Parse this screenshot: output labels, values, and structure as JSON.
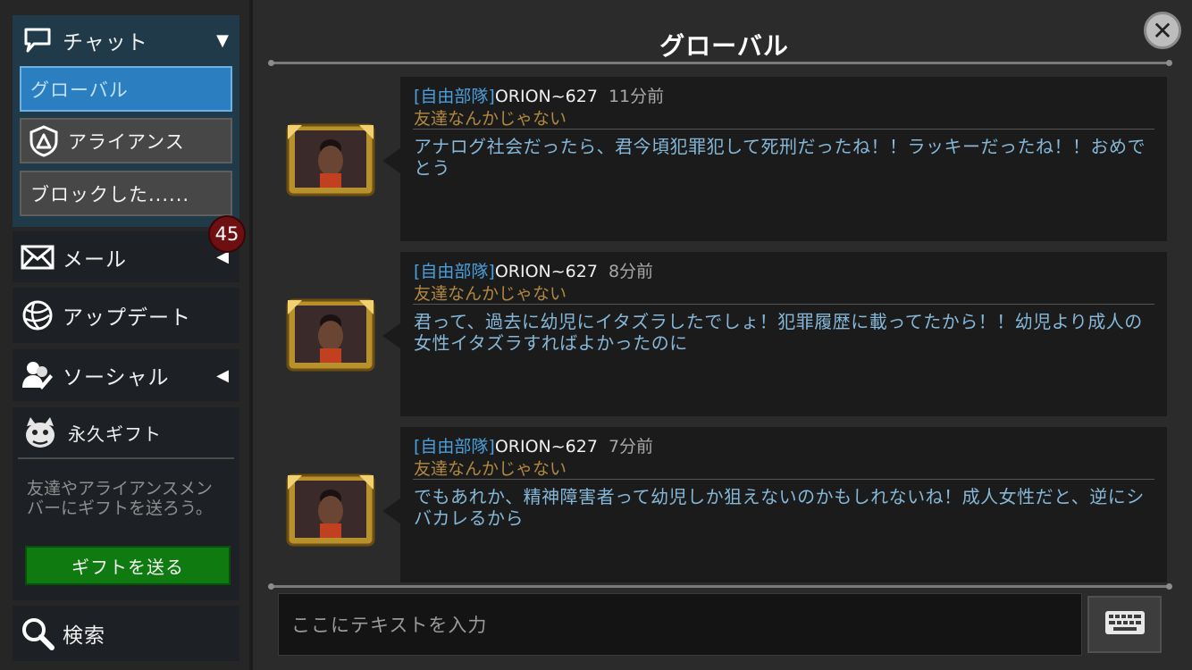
{
  "sidebar": {
    "chat": {
      "label": "チャット",
      "arrow": "▼",
      "subitems": [
        {
          "label": "グローバル",
          "active": true
        },
        {
          "label": "アライアンス",
          "active": false
        },
        {
          "label": "ブロックした......",
          "active": false
        }
      ]
    },
    "mail": {
      "label": "メール",
      "arrow": "◀",
      "badge": "45"
    },
    "update": {
      "label": "アップデート"
    },
    "social": {
      "label": "ソーシャル",
      "arrow": "◀"
    },
    "gift": {
      "label": "永久ギフト",
      "description": "友達やアライアンスメンバーにギフトを送ろう。",
      "button": "ギフトを送る"
    },
    "search": {
      "label": "検索"
    }
  },
  "main": {
    "title": "グローバル",
    "close_icon": "close-icon",
    "messages": [
      {
        "tag": "[自由部隊]",
        "name": "ORION~627",
        "time": "11分前",
        "motto": "友達なんかじゃない",
        "body": "アナログ社会だったら、君今頃犯罪犯して死刑だったね！！ラッキーだったね！！おめでとう"
      },
      {
        "tag": "[自由部隊]",
        "name": "ORION~627",
        "time": "8分前",
        "motto": "友達なんかじゃない",
        "body": "君って、過去に幼児にイタズラしたでしょ！犯罪履歴に載ってたから！！幼児より成人の女性イタズラすればよかったのに"
      },
      {
        "tag": "[自由部隊]",
        "name": "ORION~627",
        "time": "7分前",
        "motto": "友達なんかじゃない",
        "body": "でもあれか、精神障害者って幼児しか狙えないのかもしれないね！成人女性だと、逆にシバカレるから"
      }
    ],
    "input": {
      "placeholder": "ここにテキストを入力"
    },
    "keyboard_icon": "keyboard-icon"
  },
  "colors": {
    "accent": "#2b7fc0",
    "gift_button": "#0f7a10",
    "badge": "#6e0f12",
    "message_text": "#85b7d8",
    "tag": "#4a9fdc",
    "motto": "#b0883f"
  }
}
